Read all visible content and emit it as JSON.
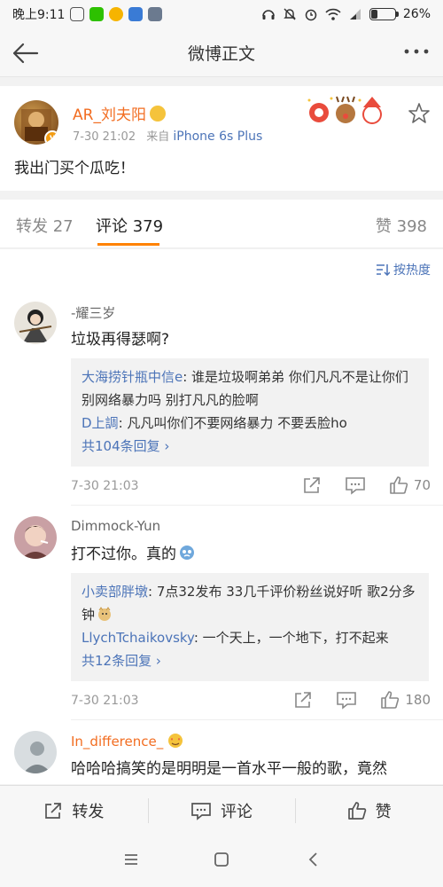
{
  "statusbar": {
    "time": "晚上9:11",
    "battery": "26%",
    "battery_level": 0.26
  },
  "navbar": {
    "title": "微博正文"
  },
  "post": {
    "author": "AR_刘夫阳",
    "time": "7-30 21:02",
    "source_prefix": "来自",
    "source": "iPhone 6s Plus",
    "text": "我出门买个瓜吃！"
  },
  "tabs": {
    "repost": "转发 27",
    "comments": "评论 379",
    "likes": "赞 398"
  },
  "sort": {
    "label": "按热度"
  },
  "comments": [
    {
      "name": "-耀三岁",
      "text": "垃圾再得瑟啊?",
      "replies": [
        {
          "name": "大海捞针瓶中信e",
          "text": ": 谁是垃圾啊弟弟 你们凡凡不是让你们别网络暴力吗 别打凡凡的脸啊"
        },
        {
          "name": "D上調",
          "text": ": 凡凡叫你们不要网络暴力 不要丢脸ho"
        }
      ],
      "more": "共104条回复",
      "time": "7-30 21:03",
      "likes": "70"
    },
    {
      "name": "Dimmock-Yun",
      "text": "打不过你。真的",
      "replies": [
        {
          "name": "小卖部胖墩",
          "text": ": 7点32发布 33几千评价粉丝说好听 歌2分多钟"
        },
        {
          "name": "LlychTchaikovsky",
          "text": ": 一个天上，一个地下，打不起来"
        }
      ],
      "more": "共12条回复",
      "time": "7-30 21:03",
      "likes": "180"
    },
    {
      "name": "In_difference_",
      "text": "哈哈哈搞笑的是明明是一首水平一般的歌，竟然"
    }
  ],
  "bottombar": {
    "repost": "转发",
    "comment": "评论",
    "like": "赞"
  },
  "colors": {
    "accent": "#ff8200",
    "link": "#4c74b8",
    "name_orange": "#f26d21"
  }
}
